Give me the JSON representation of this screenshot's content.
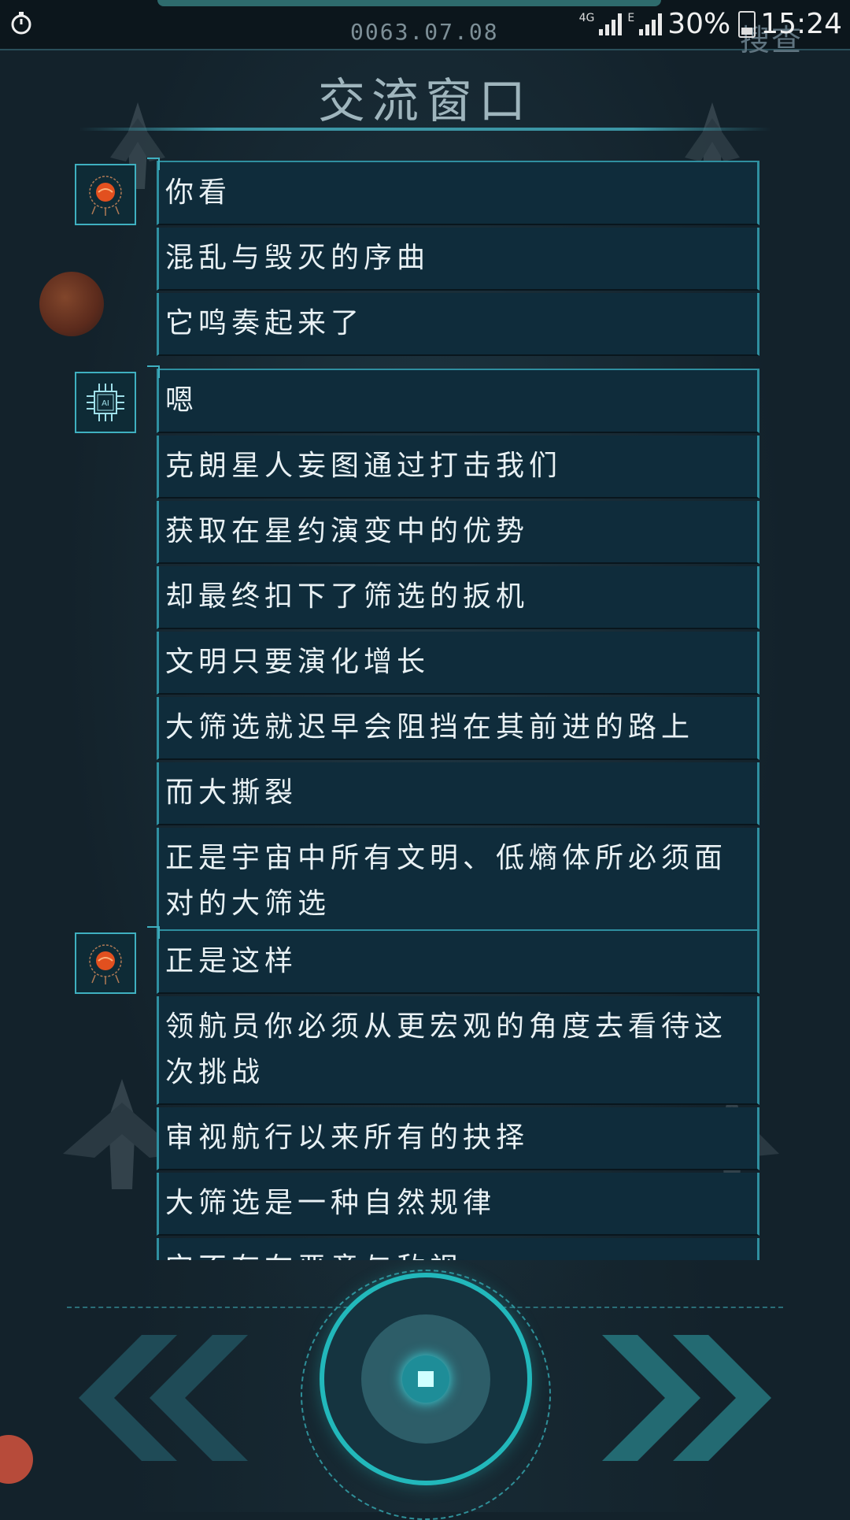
{
  "status_bar": {
    "date": "0063.07.08",
    "network": "4G",
    "network2": "E",
    "battery": "30%",
    "time": "15:24"
  },
  "skip_label": "搜查",
  "title": "交流窗口",
  "messages": [
    {
      "speaker": "planet-avatar",
      "lines": [
        "你看",
        "混乱与毁灭的序曲",
        "它鸣奏起来了"
      ]
    },
    {
      "speaker": "ai-avatar",
      "avatar_text": "AI",
      "lines": [
        "嗯",
        "克朗星人妄图通过打击我们",
        "获取在星约演变中的优势",
        "却最终扣下了筛选的扳机",
        "文明只要演化增长",
        "大筛选就迟早会阻挡在其前进的路上",
        "而大撕裂",
        "正是宇宙中所有文明、低熵体所必须面对的大筛选"
      ]
    },
    {
      "speaker": "planet-avatar",
      "lines": [
        "正是这样",
        "领航员你必须从更宏观的角度去看待这次挑战",
        "审视航行以来所有的抉择",
        "大筛选是一种自然规律",
        "它不存在恶意与敌视"
      ]
    }
  ],
  "colors": {
    "accent": "#22b8bb",
    "bubble_bg": "#0f2c3b",
    "border": "#2f8fa0"
  }
}
